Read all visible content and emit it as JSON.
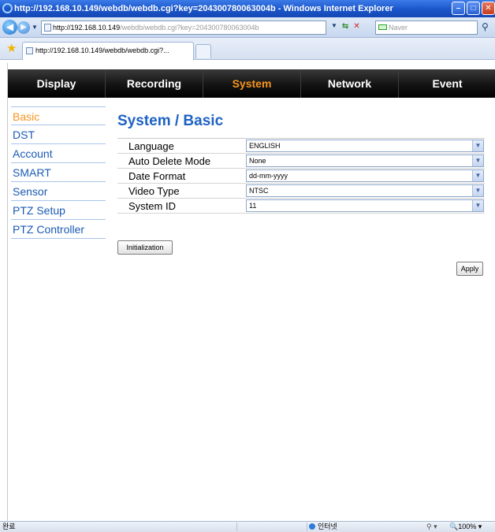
{
  "window": {
    "title": "http://192.168.10.149/webdb/webdb.cgi?key=204300780063004b - Windows Internet Explorer",
    "minimize_glyph": "–",
    "maximize_glyph": "□",
    "close_glyph": "✕"
  },
  "address_bar": {
    "url_host": "http://192.168.10.149",
    "url_path": "/webdb/webdb.cgi?key=204300780063004b",
    "search_placeholder": "Naver"
  },
  "tab": {
    "label": "http://192.168.10.149/webdb/webdb.cgi?..."
  },
  "topnav": {
    "items": [
      {
        "label": "Display",
        "active": false
      },
      {
        "label": "Recording",
        "active": false
      },
      {
        "label": "System",
        "active": true
      },
      {
        "label": "Network",
        "active": false
      },
      {
        "label": "Event",
        "active": false
      }
    ],
    "active_color": "#f7941d"
  },
  "sidebar": {
    "items": [
      {
        "label": "Basic",
        "active": true
      },
      {
        "label": "DST",
        "active": false
      },
      {
        "label": "Account",
        "active": false
      },
      {
        "label": "SMART",
        "active": false
      },
      {
        "label": "Sensor",
        "active": false
      },
      {
        "label": "PTZ Setup",
        "active": false
      },
      {
        "label": "PTZ Controller",
        "active": false
      }
    ],
    "link_color": "#1a5ab3"
  },
  "main": {
    "title": "System / Basic",
    "settings": [
      {
        "label": "Language",
        "value": "ENGLISH"
      },
      {
        "label": "Auto Delete Mode",
        "value": "None"
      },
      {
        "label": "Date Format",
        "value": "dd-mm-yyyy"
      },
      {
        "label": "Video Type",
        "value": "NTSC"
      },
      {
        "label": "System ID",
        "value": "11"
      }
    ],
    "initialization_label": "Initialization",
    "apply_label": "Apply"
  },
  "status_bar": {
    "text": "완료",
    "zone": "인터넷",
    "protect": "⚲ ▾",
    "zoom": "🔍100% ▾"
  }
}
